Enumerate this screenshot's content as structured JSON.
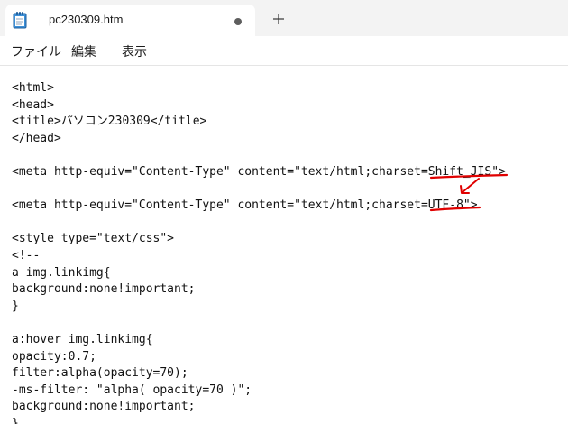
{
  "app": {
    "icon": "notepad-icon",
    "tab": {
      "title": "pc230309.htm",
      "unsaved_icon": "unsaved-dot-icon"
    },
    "new_tab_icon": "plus-icon"
  },
  "menu": [
    {
      "label": "ファイル"
    },
    {
      "label": "編集"
    },
    {
      "label": "表示"
    }
  ],
  "editor": {
    "lines": [
      "<html>",
      "<head>",
      "<title>パソコン230309</title>",
      "</head>",
      "",
      "<meta http-equiv=\"Content-Type\" content=\"text/html;charset=Shift_JIS\">",
      "",
      "<meta http-equiv=\"Content-Type\" content=\"text/html;charset=UTF-8\">",
      "",
      "<style type=\"text/css\">",
      "<!--",
      "a img.linkimg{",
      "background:none!important;",
      "}",
      "",
      "a:hover img.linkimg{",
      "opacity:0.7;",
      "filter:alpha(opacity=70);",
      "-ms-filter: \"alpha( opacity=70 )\";",
      "background:none!important;",
      "}"
    ]
  },
  "annotations": {
    "color": "#e00000",
    "arrow_icon": "red-arrow-icon"
  },
  "colors": {
    "tab_bar_bg": "#f3f3f3",
    "editor_bg": "#ffffff",
    "text": "#111111",
    "annotation": "#e00000"
  }
}
